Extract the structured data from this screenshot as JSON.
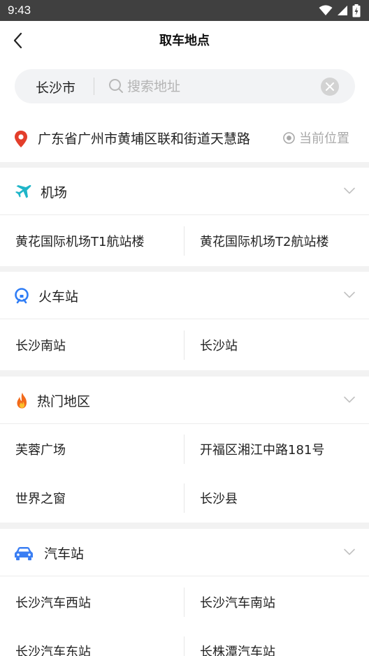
{
  "status_bar": {
    "time": "9:43"
  },
  "header": {
    "title": "取车地点"
  },
  "search": {
    "city": "长沙市",
    "placeholder": "搜索地址",
    "value": ""
  },
  "current_location": {
    "address": "广东省广州市黄埔区联和街道天慧路",
    "current_label": "当前位置"
  },
  "colors": {
    "pin": "#e33e2b",
    "airport": "#1fb5c8",
    "train": "#2f7df6",
    "hot": "#f26a1b",
    "bus": "#3a7ef3"
  },
  "sections": [
    {
      "title": "机场",
      "icon": "plane-icon",
      "items": [
        "黄花国际机场T1航站楼",
        "黄花国际机场T2航站楼"
      ]
    },
    {
      "title": "火车站",
      "icon": "train-icon",
      "items": [
        "长沙南站",
        "长沙站"
      ]
    },
    {
      "title": "热门地区",
      "icon": "fire-icon",
      "items": [
        "芙蓉广场",
        "开福区湘江中路181号",
        "世界之窗",
        "长沙县"
      ]
    },
    {
      "title": "汽车站",
      "icon": "car-icon",
      "items": [
        "长沙汽车西站",
        "长沙汽车南站",
        "长沙汽车东站",
        "长株潭汽车站"
      ]
    }
  ]
}
